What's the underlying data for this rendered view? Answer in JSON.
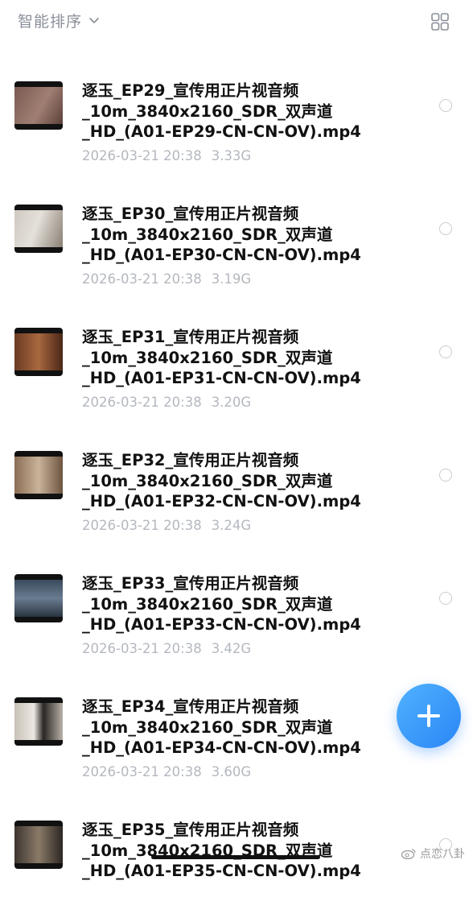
{
  "toolbar": {
    "sort_label": "智能排序",
    "sort_icon": "chevron-down-icon",
    "view_icon": "grid-view-icon"
  },
  "files": [
    {
      "name": "逐玉_EP29_宣传用正片视音频\n_10m_3840x2160_SDR_双声道\n_HD_(A01-EP29-CN-CN-OV).mp4",
      "date": "2026-03-21 20:38",
      "size": "3.33G"
    },
    {
      "name": "逐玉_EP30_宣传用正片视音频\n_10m_3840x2160_SDR_双声道\n_HD_(A01-EP30-CN-CN-OV).mp4",
      "date": "2026-03-21 20:38",
      "size": "3.19G"
    },
    {
      "name": "逐玉_EP31_宣传用正片视音频\n_10m_3840x2160_SDR_双声道\n_HD_(A01-EP31-CN-CN-OV).mp4",
      "date": "2026-03-21 20:38",
      "size": "3.20G"
    },
    {
      "name": "逐玉_EP32_宣传用正片视音频\n_10m_3840x2160_SDR_双声道\n_HD_(A01-EP32-CN-CN-OV).mp4",
      "date": "2026-03-21 20:38",
      "size": "3.24G"
    },
    {
      "name": "逐玉_EP33_宣传用正片视音频\n_10m_3840x2160_SDR_双声道\n_HD_(A01-EP33-CN-CN-OV).mp4",
      "date": "2026-03-21 20:38",
      "size": "3.42G"
    },
    {
      "name": "逐玉_EP34_宣传用正片视音频\n_10m_3840x2160_SDR_双声道\n_HD_(A01-EP34-CN-CN-OV).mp4",
      "date": "2026-03-21 20:38",
      "size": "3.60G"
    },
    {
      "name": "逐玉_EP35_宣传用正片视音频\n_10m_3840x2160_SDR_双声道\n_HD_(A01-EP35-CN-CN-OV).mp4",
      "date": "",
      "size": ""
    }
  ],
  "fab": {
    "icon": "plus-icon",
    "color": "#2a86f5"
  },
  "watermark": {
    "text": "点恋八卦",
    "icon": "weibo-icon"
  },
  "colors": {
    "accent": "#2a86f5",
    "muted_text": "#b4b8bf",
    "sort_text": "#8a8f99"
  }
}
